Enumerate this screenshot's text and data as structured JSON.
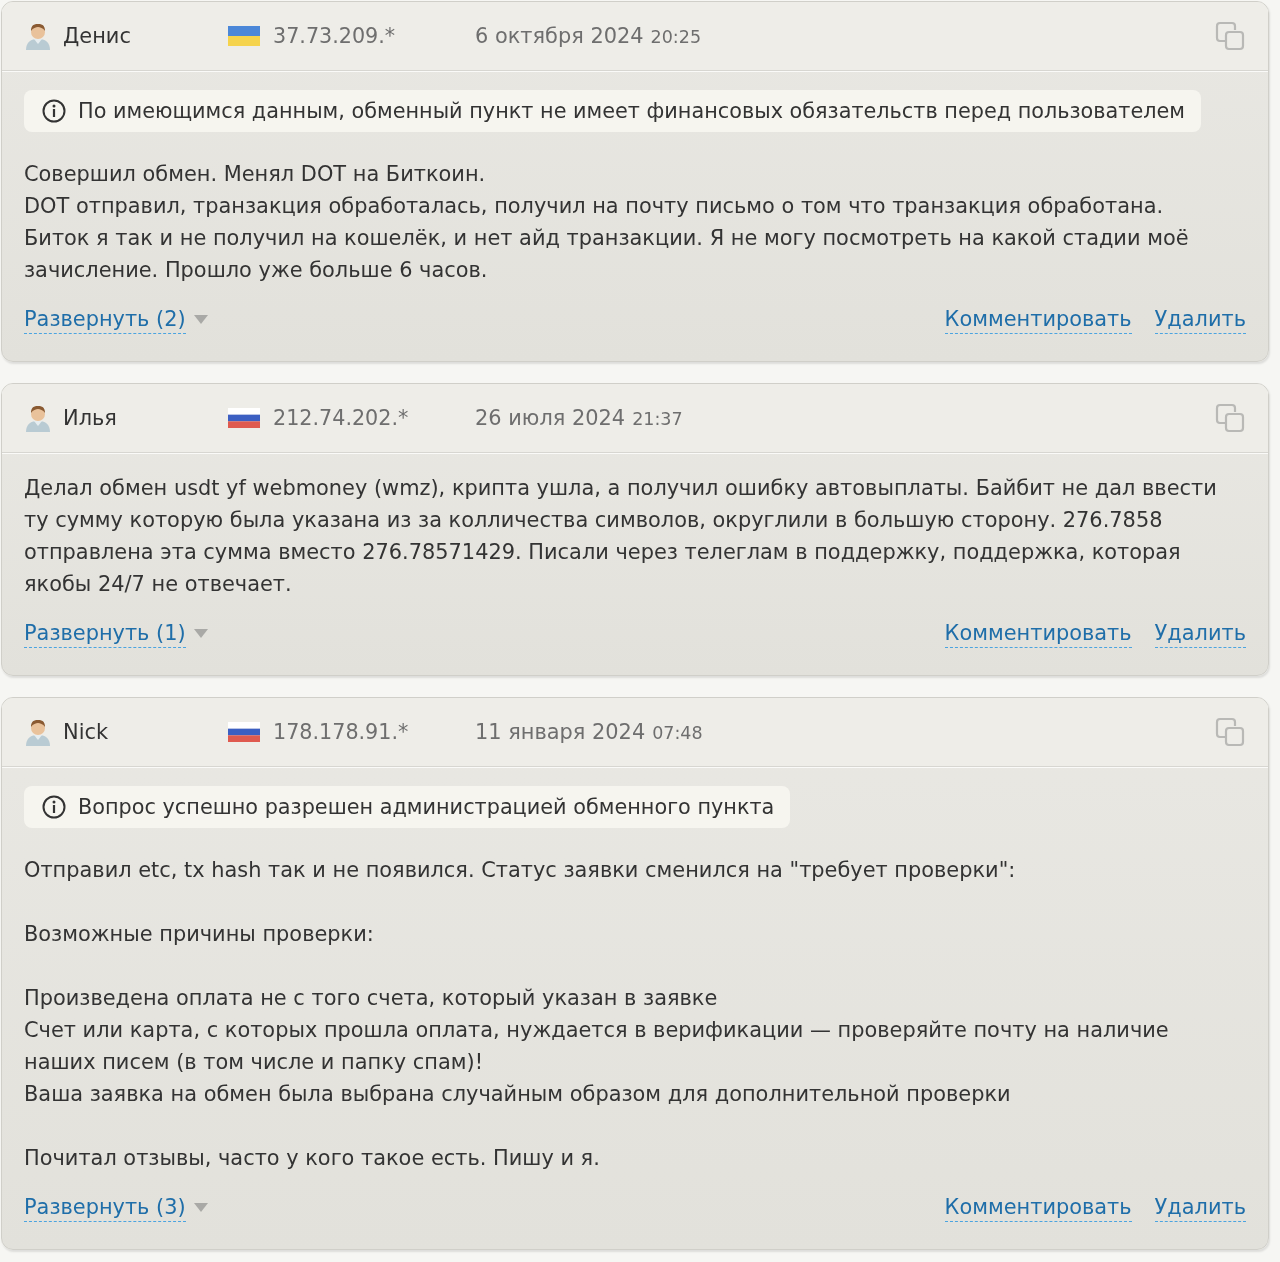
{
  "comments": [
    {
      "author": "Денис",
      "flag": {
        "kind": "ua"
      },
      "ip": "37.73.209.*",
      "date": "6 октября 2024",
      "time": "20:25",
      "notice": "По имеющимся данным, обменный пункт не имеет финансовых обязательств перед пользователем",
      "body": [
        [
          "Совершил обмен. Менял DOT на Биткоин.",
          "DOT отправил, транзакция обработалась, получил на почту письмо о том что транзакция обработана.",
          "Биток я так и не получил на кошелёк, и нет айд транзакции. Я не могу посмотреть на какой стадии моё зачисление. Прошло уже больше 6 часов."
        ]
      ],
      "expand": "Развернуть (2)",
      "actions": [
        "Комментировать",
        "Удалить"
      ]
    },
    {
      "author": "Илья",
      "flag": {
        "kind": "ru"
      },
      "ip": "212.74.202.*",
      "date": "26 июля 2024",
      "time": "21:37",
      "body": [
        [
          "Делал обмен usdt yf webmoney (wmz), крипта ушла, а получил ошибку автовыплаты. Байбит не дал ввести ту сумму которую была указана из за колличества символов, округлили в большую сторону. 276.7858 отправлена эта сумма вместо 276.78571429. Писали через телеглам в поддержку, поддержка, которая якобы 24/7 не отвечает."
        ]
      ],
      "expand": "Развернуть (1)",
      "actions": [
        "Комментировать",
        "Удалить"
      ]
    },
    {
      "author": "Nick",
      "flag": {
        "kind": "ru"
      },
      "ip": "178.178.91.*",
      "date": "11 января 2024",
      "time": "07:48",
      "notice": "Вопрос успешно разрешен администрацией обменного пункта",
      "body": [
        [
          "Отправил etc, tx hash так и не появился. Статус заявки сменился на \"требует проверки\":"
        ],
        [
          "Возможные причины проверки:"
        ],
        [
          "Произведена оплата не с того счета, который указан в заявке",
          "Счет или карта, с которых прошла оплата, нуждается в верификации — проверяйте почту на наличие наших писем (в том числе и папку спам)!",
          "Ваша заявка на обмен была выбрана случайным образом для дополнительной проверки"
        ],
        [
          "Почитал отзывы, часто у кого такое есть. Пишу и я."
        ]
      ],
      "expand": "Развернуть (3)",
      "actions": [
        "Комментировать",
        "Удалить"
      ]
    }
  ]
}
